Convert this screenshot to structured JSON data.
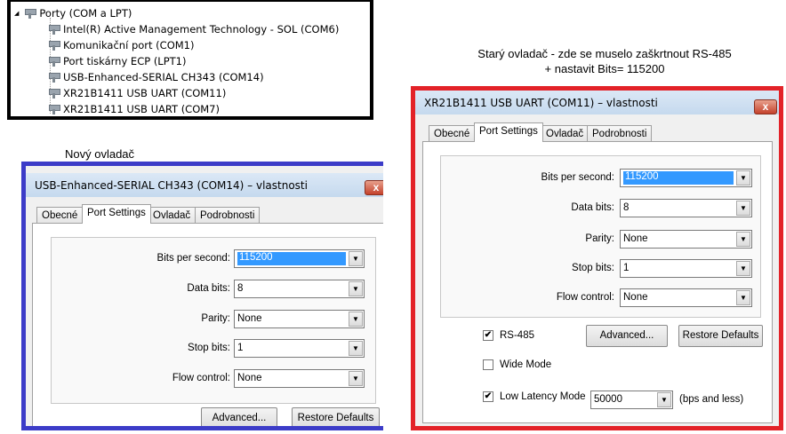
{
  "device_tree": {
    "category": "Porty (COM a LPT)",
    "items": [
      "Intel(R) Active Management Technology - SOL (COM6)",
      "Komunikační port (COM1)",
      "Port tiskárny ECP (LPT1)",
      "USB-Enhanced-SERIAL CH343 (COM14)",
      "XR21B1411 USB UART (COM11)",
      "XR21B1411 USB UART (COM7)"
    ]
  },
  "new_driver": {
    "caption": "Nový ovladač",
    "title": "USB-Enhanced-SERIAL CH343 (COM14)  – vlastnosti",
    "close": "x",
    "tabs": [
      "Obecné",
      "Port Settings",
      "Ovladač",
      "Podrobnosti"
    ],
    "fields": [
      {
        "label": "Bits per second:",
        "value": "115200"
      },
      {
        "label": "Data bits:",
        "value": "8"
      },
      {
        "label": "Parity:",
        "value": "None"
      },
      {
        "label": "Stop bits:",
        "value": "1"
      },
      {
        "label": "Flow control:",
        "value": "None"
      }
    ],
    "advanced": "Advanced...",
    "restore": "Restore Defaults",
    "border_color": "#3c3cc8"
  },
  "old_driver": {
    "caption_line1": "Starý ovladač - zde se muselo zaškrtnout RS-485",
    "caption_line2": "+ nastavit Bits= 115200",
    "title": "XR21B1411 USB UART (COM11)  – vlastnosti",
    "close": "x",
    "tabs": [
      "Obecné",
      "Port Settings",
      "Ovladač",
      "Podrobnosti"
    ],
    "fields": [
      {
        "label": "Bits per second:",
        "value": "115200"
      },
      {
        "label": "Data bits:",
        "value": "8"
      },
      {
        "label": "Parity:",
        "value": "None"
      },
      {
        "label": "Stop bits:",
        "value": "1"
      },
      {
        "label": "Flow control:",
        "value": "None"
      }
    ],
    "rs485": {
      "label": "RS-485",
      "checked": true,
      "mark": "✔"
    },
    "wide_mode": {
      "label": "Wide Mode",
      "checked": false
    },
    "low_latency": {
      "label": "Low Latency Mode",
      "checked": true,
      "mark": "✔",
      "value": "50000",
      "suffix": "(bps and less)"
    },
    "advanced": "Advanced...",
    "restore": "Restore Defaults",
    "border_color": "#e32228"
  }
}
